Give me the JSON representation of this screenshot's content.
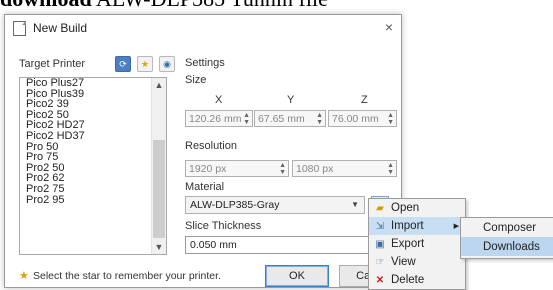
{
  "doc_heading": {
    "bold": "download",
    "rest": " ALW-DLP385 Tunnin file"
  },
  "dialog": {
    "title": "New Build",
    "close": "×"
  },
  "target_printer": {
    "label": "Target Printer",
    "items": [
      "Pico Plus27",
      "Pico Plus39",
      "Pico2 39",
      "Pico2 50",
      "Pico2 HD27",
      "Pico2 HD37",
      "Pro 50",
      "Pro 75",
      "Pro2 50",
      "Pro2 62",
      "Pro2 75",
      "Pro2 95"
    ]
  },
  "settings": {
    "label": "Settings",
    "size": {
      "label": "Size",
      "x_label": "X",
      "y_label": "Y",
      "z_label": "Z",
      "x_value": "120.26 mm",
      "y_value": "67.65 mm",
      "z_value": "76.00 mm"
    },
    "resolution": {
      "label": "Resolution",
      "w_value": "1920 px",
      "h_value": "1080 px"
    },
    "material": {
      "label": "Material",
      "selected": "ALW-DLP385-Gray"
    },
    "slice_thickness": {
      "label": "Slice Thickness",
      "value": "0.050 mm"
    }
  },
  "footer": {
    "hint": "Select the star to remember your printer.",
    "ok_label": "OK",
    "cancel_label": "Canc"
  },
  "context_menu": {
    "items": [
      {
        "label": "Open",
        "icon": "folder-icon"
      },
      {
        "label": "Import",
        "icon": "import-icon"
      },
      {
        "label": "Export",
        "icon": "export-icon"
      },
      {
        "label": "View",
        "icon": "view-icon"
      },
      {
        "label": "Delete",
        "icon": "delete-icon"
      }
    ],
    "submenu": [
      "Composer",
      "Downloads"
    ]
  }
}
